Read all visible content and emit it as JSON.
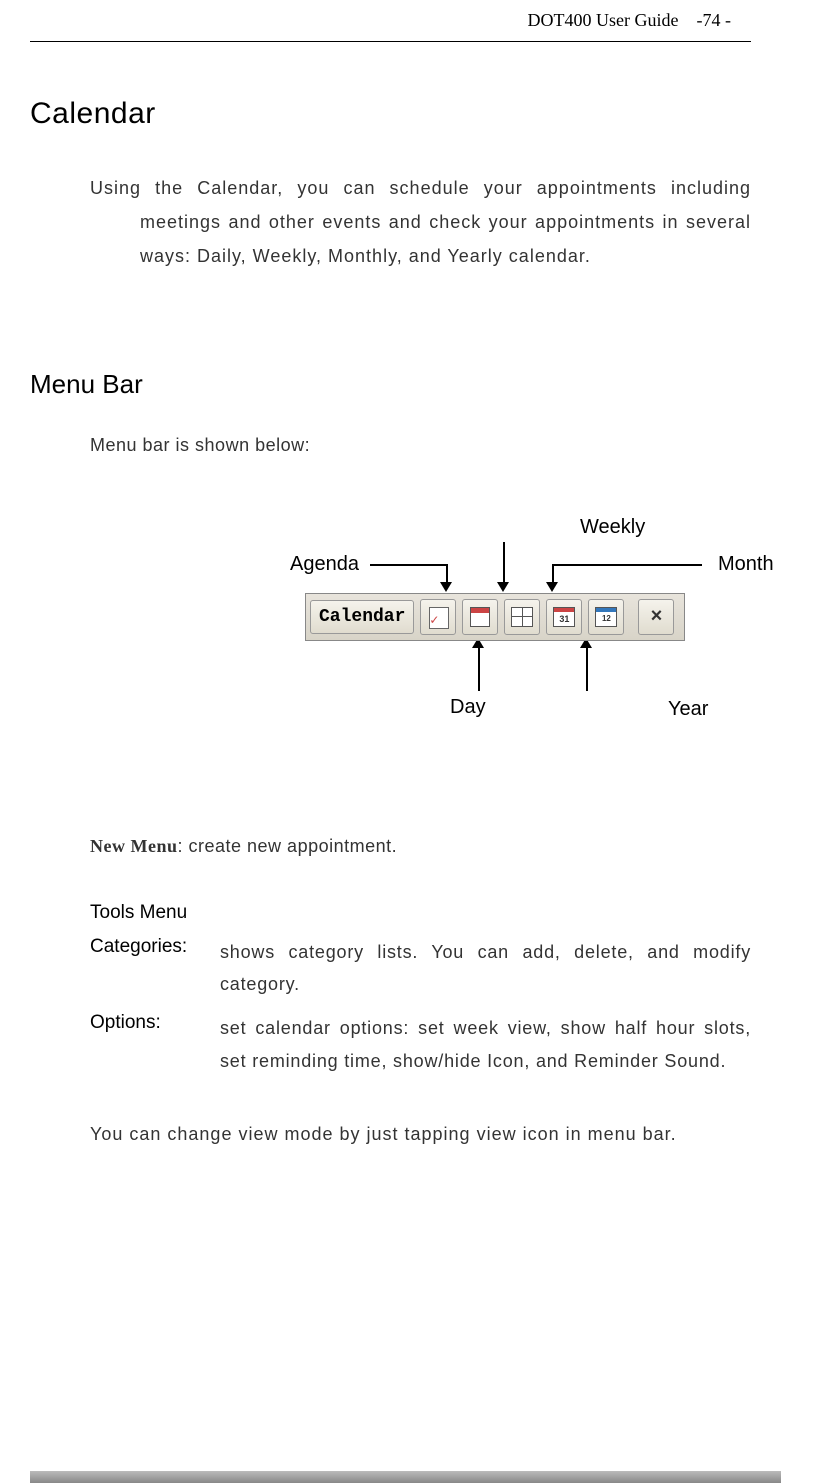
{
  "header": {
    "guide": "DOT400 User Guide",
    "page": "-74 -"
  },
  "title": "Calendar",
  "intro": "Using the Calendar, you can schedule your appointments including meetings and other events and check your appointments in several ways: Daily, Weekly, Monthly, and Yearly calendar.",
  "section2_title": "Menu Bar",
  "menu_intro": "Menu bar is shown below:",
  "labels": {
    "agenda": "Agenda",
    "weekly": "Weekly",
    "month": "Month",
    "day": "Day",
    "year": "Year"
  },
  "menubar": {
    "button_label": "Calendar",
    "month_num": "31",
    "year_num": "12",
    "close": "×"
  },
  "new_menu_prefix": "New Menu",
  "new_menu_rest": ": create new appointment.",
  "tools_heading": "Tools Menu",
  "categories_term": "Categories:",
  "categories_desc": "shows category lists. You can add, delete, and modify category.",
  "options_term": "Options:",
  "options_desc": "set calendar options: set week view, show half hour slots, set reminding time, show/hide Icon, and Reminder Sound.",
  "closing": "You can change view mode by just tapping view icon in menu bar."
}
